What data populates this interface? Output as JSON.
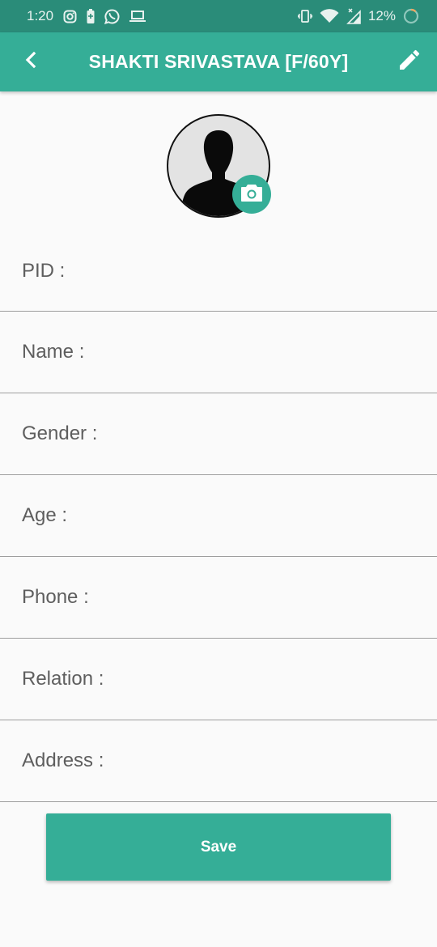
{
  "status_bar": {
    "time": "1:20",
    "battery_percent": "12%",
    "left_icons": [
      "instagram-icon",
      "battery-saver-icon",
      "whatsapp-icon",
      "laptop-icon"
    ],
    "right_icons": [
      "vibrate-icon",
      "wifi-icon",
      "no-signal-icon",
      "battery-ring-icon"
    ]
  },
  "app_bar": {
    "title": "SHAKTI SRIVASTAVA [F/60Y]",
    "back_icon": "chevron-left-icon",
    "action_icon": "pencil-icon"
  },
  "colors": {
    "status_bar": "#2a8c79",
    "primary": "#35ae97",
    "background": "#fafafa",
    "divider": "#9e9e9e",
    "label_text": "#5e5e5e"
  },
  "profile": {
    "avatar_icon": "person-silhouette-icon",
    "camera_icon": "camera-icon"
  },
  "form": {
    "fields": [
      {
        "label": "PID :",
        "value": ""
      },
      {
        "label": "Name :",
        "value": ""
      },
      {
        "label": "Gender :",
        "value": ""
      },
      {
        "label": "Age :",
        "value": ""
      },
      {
        "label": "Phone :",
        "value": ""
      },
      {
        "label": "Relation :",
        "value": ""
      },
      {
        "label": "Address :",
        "value": ""
      }
    ]
  },
  "save_button": {
    "label": "Save"
  }
}
